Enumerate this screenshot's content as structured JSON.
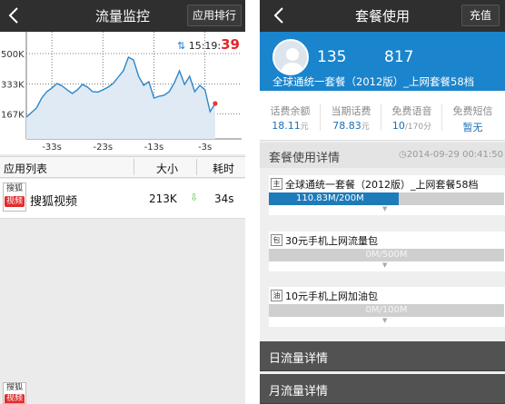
{
  "left": {
    "header": {
      "title": "流量监控",
      "right_button": "应用排行"
    },
    "status": {
      "arrows": "⇅",
      "time": "15:19:",
      "seconds": "39"
    },
    "chart_data": {
      "type": "line",
      "title": "",
      "y_ticks": [
        "500K",
        "333K",
        "167K"
      ],
      "y_tick_values": [
        500,
        333,
        167
      ],
      "x_ticks": [
        "-33s",
        "-23s",
        "-13s",
        "-3s"
      ],
      "x_tick_values": [
        -33,
        -23,
        -13,
        -3
      ],
      "xlim": [
        -38,
        4
      ],
      "ylim": [
        30,
        560
      ],
      "grid": true,
      "series": [
        {
          "x": [
            -38,
            -37,
            -36,
            -35,
            -34,
            -33,
            -32,
            -31,
            -30,
            -29,
            -28,
            -27,
            -26,
            -25,
            -24,
            -23,
            -22,
            -21,
            -20,
            -19,
            -18,
            -17,
            -16,
            -15,
            -14,
            -13,
            -12,
            -11,
            -10,
            -9,
            -8,
            -7,
            -6,
            -5,
            -4,
            -3,
            -2,
            -1
          ],
          "values": [
            150,
            175,
            200,
            255,
            290,
            310,
            335,
            322,
            300,
            280,
            300,
            330,
            315,
            290,
            288,
            300,
            315,
            335,
            370,
            405,
            480,
            465,
            375,
            325,
            345,
            255,
            265,
            270,
            290,
            340,
            405,
            330,
            375,
            290,
            325,
            300,
            180,
            225
          ]
        }
      ],
      "line_color": "#2e86c9",
      "fill_color": "#dfeaf4",
      "end_marker_color": "#e23a3a"
    },
    "list": {
      "col_app": "应用列表",
      "col_size": "大小",
      "col_time": "耗时",
      "rows": [
        {
          "icon_top": "搜狐",
          "icon_bottom": "视频",
          "name": "搜狐视频",
          "size": "213K",
          "arrow": "⇩",
          "time": "34s"
        }
      ]
    },
    "corner_icon": {
      "top": "搜狐",
      "bottom": "视频"
    }
  },
  "right": {
    "header": {
      "title": "套餐使用",
      "right_button": "充值"
    },
    "profile": {
      "phone_prefix": "135",
      "phone_suffix": "817",
      "plan": "全球通统一套餐（2012版）_上网套餐58档"
    },
    "stats": [
      {
        "label": "话费余额",
        "value": "18.11",
        "unit": "元"
      },
      {
        "label": "当期话费",
        "value": "78.83",
        "unit": "元"
      },
      {
        "label": "免费语音",
        "value": "10",
        "unit": "/170分"
      },
      {
        "label": "免费短信",
        "value": "暂无",
        "unit": ""
      }
    ],
    "detail": {
      "title": "套餐使用详情",
      "date": "2014-09-29 00:41:50",
      "clock_icon": "◷"
    },
    "packages": [
      {
        "badge": "主",
        "name": "全球通统一套餐（2012版）_上网套餐58档",
        "usage": "110.83M/200M",
        "used_fraction": 0.554
      },
      {
        "badge": "包",
        "name": "30元手机上网流量包",
        "usage": "0M/500M",
        "used_fraction": 0
      },
      {
        "badge": "油",
        "name": "10元手机上网加油包",
        "usage": "0M/100M",
        "used_fraction": 0
      }
    ],
    "nav": {
      "daily": "日流量详情",
      "monthly": "月流量详情"
    }
  }
}
